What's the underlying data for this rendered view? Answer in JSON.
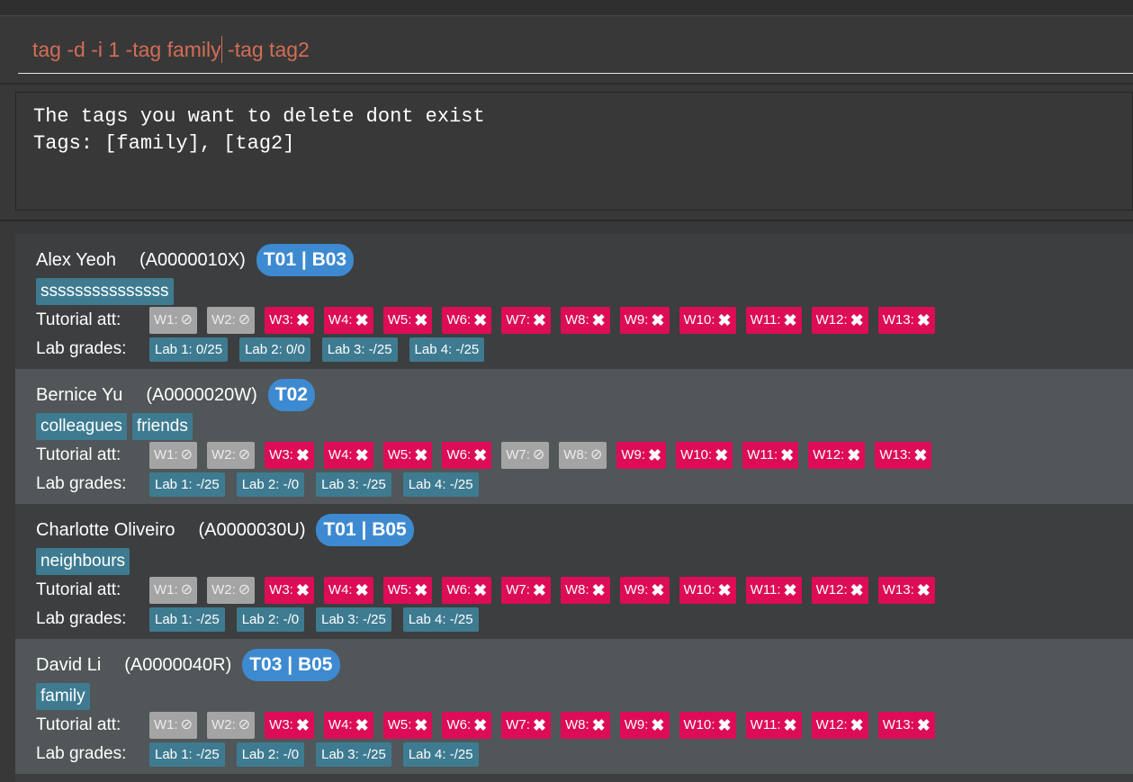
{
  "command": {
    "before_caret": "tag -d -i 1 -tag family",
    "after_caret": " -tag tag2"
  },
  "result": {
    "line1": "The tags you want to delete dont exist",
    "line2": "Tags: [family], [tag2]"
  },
  "labels": {
    "tutorial": "Tutorial att:",
    "lab": "Lab grades:"
  },
  "icons": {
    "absent": "cross-icon",
    "not_applicable": "circle-slash-icon"
  },
  "colors": {
    "absent": "#dd0c56",
    "not_applicable": "#a4a4a4",
    "tag": "#3e7b91",
    "group": "#3e8ad1"
  },
  "persons": [
    {
      "name": "Alex Yeoh",
      "id": "(A0000010X)",
      "group": "T01 | B03",
      "tags": [
        "sssssssssssssss"
      ],
      "attendance": [
        {
          "label": "W1:",
          "status": "na"
        },
        {
          "label": "W2:",
          "status": "na"
        },
        {
          "label": "W3:",
          "status": "absent"
        },
        {
          "label": "W4:",
          "status": "absent"
        },
        {
          "label": "W5:",
          "status": "absent"
        },
        {
          "label": "W6:",
          "status": "absent"
        },
        {
          "label": "W7:",
          "status": "absent"
        },
        {
          "label": "W8:",
          "status": "absent"
        },
        {
          "label": "W9:",
          "status": "absent"
        },
        {
          "label": "W10:",
          "status": "absent"
        },
        {
          "label": "W11:",
          "status": "absent"
        },
        {
          "label": "W12:",
          "status": "absent"
        },
        {
          "label": "W13:",
          "status": "absent"
        }
      ],
      "labs": [
        "Lab 1: 0/25",
        "Lab 2: 0/0",
        "Lab 3: -/25",
        "Lab 4: -/25"
      ]
    },
    {
      "name": "Bernice Yu",
      "id": "(A0000020W)",
      "group": "T02",
      "tags": [
        "colleagues",
        "friends"
      ],
      "attendance": [
        {
          "label": "W1:",
          "status": "na"
        },
        {
          "label": "W2:",
          "status": "na"
        },
        {
          "label": "W3:",
          "status": "absent"
        },
        {
          "label": "W4:",
          "status": "absent"
        },
        {
          "label": "W5:",
          "status": "absent"
        },
        {
          "label": "W6:",
          "status": "absent"
        },
        {
          "label": "W7:",
          "status": "na"
        },
        {
          "label": "W8:",
          "status": "na"
        },
        {
          "label": "W9:",
          "status": "absent"
        },
        {
          "label": "W10:",
          "status": "absent"
        },
        {
          "label": "W11:",
          "status": "absent"
        },
        {
          "label": "W12:",
          "status": "absent"
        },
        {
          "label": "W13:",
          "status": "absent"
        }
      ],
      "labs": [
        "Lab 1: -/25",
        "Lab 2: -/0",
        "Lab 3: -/25",
        "Lab 4: -/25"
      ]
    },
    {
      "name": "Charlotte Oliveiro",
      "id": "(A0000030U)",
      "group": "T01 | B05",
      "tags": [
        "neighbours"
      ],
      "attendance": [
        {
          "label": "W1:",
          "status": "na"
        },
        {
          "label": "W2:",
          "status": "na"
        },
        {
          "label": "W3:",
          "status": "absent"
        },
        {
          "label": "W4:",
          "status": "absent"
        },
        {
          "label": "W5:",
          "status": "absent"
        },
        {
          "label": "W6:",
          "status": "absent"
        },
        {
          "label": "W7:",
          "status": "absent"
        },
        {
          "label": "W8:",
          "status": "absent"
        },
        {
          "label": "W9:",
          "status": "absent"
        },
        {
          "label": "W10:",
          "status": "absent"
        },
        {
          "label": "W11:",
          "status": "absent"
        },
        {
          "label": "W12:",
          "status": "absent"
        },
        {
          "label": "W13:",
          "status": "absent"
        }
      ],
      "labs": [
        "Lab 1: -/25",
        "Lab 2: -/0",
        "Lab 3: -/25",
        "Lab 4: -/25"
      ]
    },
    {
      "name": "David Li",
      "id": "(A0000040R)",
      "group": "T03 | B05",
      "tags": [
        "family"
      ],
      "attendance": [
        {
          "label": "W1:",
          "status": "na"
        },
        {
          "label": "W2:",
          "status": "na"
        },
        {
          "label": "W3:",
          "status": "absent"
        },
        {
          "label": "W4:",
          "status": "absent"
        },
        {
          "label": "W5:",
          "status": "absent"
        },
        {
          "label": "W6:",
          "status": "absent"
        },
        {
          "label": "W7:",
          "status": "absent"
        },
        {
          "label": "W8:",
          "status": "absent"
        },
        {
          "label": "W9:",
          "status": "absent"
        },
        {
          "label": "W10:",
          "status": "absent"
        },
        {
          "label": "W11:",
          "status": "absent"
        },
        {
          "label": "W12:",
          "status": "absent"
        },
        {
          "label": "W13:",
          "status": "absent"
        }
      ],
      "labs": [
        "Lab 1: -/25",
        "Lab 2: -/0",
        "Lab 3: -/25",
        "Lab 4: -/25"
      ]
    }
  ]
}
